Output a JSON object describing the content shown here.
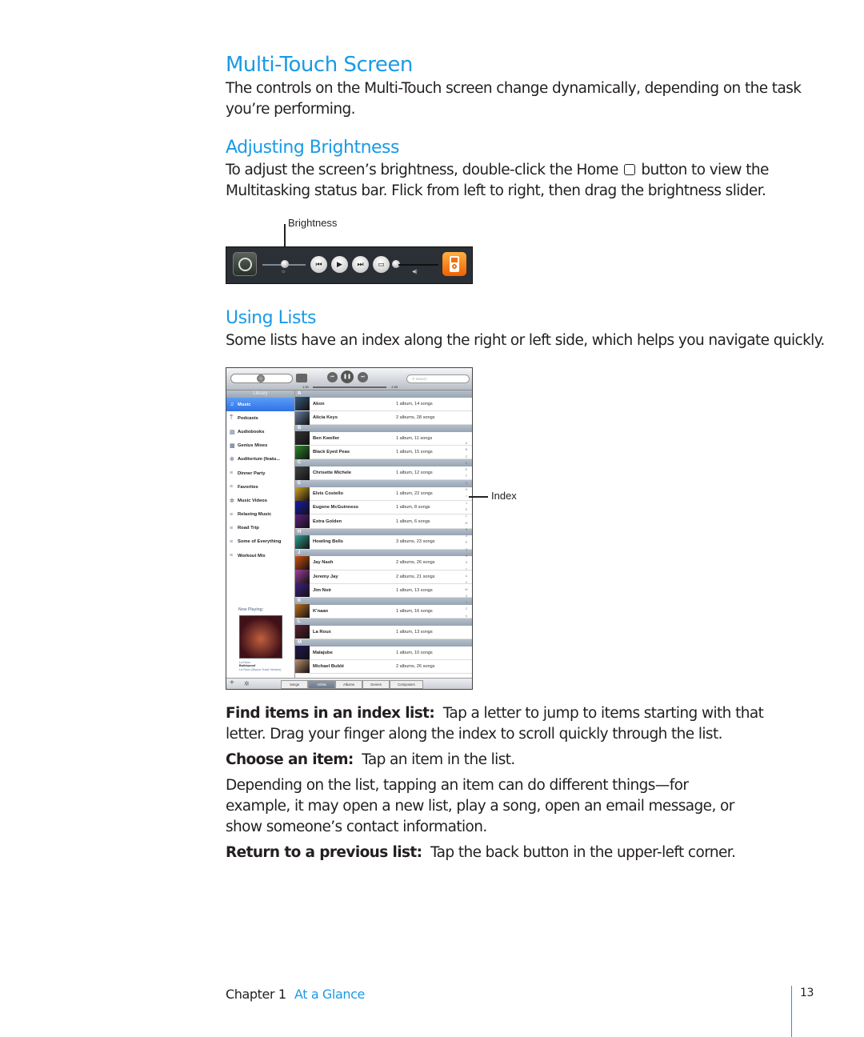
{
  "sections": {
    "title": "Multi-Touch Screen",
    "intro": "The controls on the Multi-Touch screen change dynamically, depending on the task you’re performing.",
    "brightness_heading": "Adjusting Brightness",
    "brightness_text_1": "To adjust the screen’s brightness, double-click the Home",
    "brightness_text_2": "button to view the Multitasking status bar. Flick from left to right, then drag the brightness slider.",
    "brightness_callout": "Brightness",
    "lists_heading": "Using Lists",
    "lists_text": "Some lists have an index along the right or left side, which helps you navigate quickly.",
    "index_callout": "Index",
    "find_label": "Find items in an index list:",
    "find_text": "Tap a letter to jump to items starting with that letter. Drag your finger along the index to scroll quickly through the list.",
    "choose_label": "Choose an item:",
    "choose_text": "Tap an item in the list.",
    "depending_text": "Depending on the list, tapping an item can do different things—for example, it may open a new list, play a song, open an email message, or show someone’s contact information.",
    "return_label": "Return to a previous list:",
    "return_text": "Tap the back button in the upper-left corner."
  },
  "brightness_bar": {
    "icons": [
      "rotation-lock-icon",
      "brightness-icon",
      "previous-icon",
      "play-icon",
      "next-icon",
      "airplay-icon",
      "volume-icon",
      "ipod-app-icon"
    ],
    "brightness_level": 0.45,
    "volume_level": 0.05
  },
  "ipad": {
    "toolbar": {
      "elapsed": "1:30",
      "remaining": "-1:55",
      "search_placeholder": "Search"
    },
    "library_label": "Library",
    "sidebar": [
      {
        "label": "Music",
        "icon": "♫",
        "selected": true
      },
      {
        "label": "Podcasts",
        "icon": "⍑"
      },
      {
        "label": "Audiobooks",
        "icon": "▤"
      },
      {
        "label": "Genius Mixes",
        "icon": "▦"
      },
      {
        "label": "Auditorium (featu...",
        "icon": "✲"
      },
      {
        "label": "Dinner Party",
        "icon": "≡"
      },
      {
        "label": "Favorites",
        "icon": "≡"
      },
      {
        "label": "Music Videos",
        "icon": "✲"
      },
      {
        "label": "Relaxing Music",
        "icon": "≡"
      },
      {
        "label": "Road Trip",
        "icon": "≡"
      },
      {
        "label": "Some of Everything",
        "icon": "≡"
      },
      {
        "label": "Workout Mix",
        "icon": "≡"
      }
    ],
    "now_playing": {
      "label": "Now Playing:",
      "artist": "La Roux",
      "song": "Bulletproof",
      "album": "La Roux (Bonus Track Version)"
    },
    "sections": [
      {
        "letter": "A",
        "rows": [
          {
            "name": "Akon",
            "count": "1 album, 14 songs",
            "color": "#3a5a80"
          },
          {
            "name": "Alicia Keys",
            "count": "2 albums, 28 songs",
            "color": "#6a7fa0"
          }
        ]
      },
      {
        "letter": "B",
        "rows": [
          {
            "name": "Ben Kweller",
            "count": "1 album, 11 songs",
            "color": "#333"
          },
          {
            "name": "Black Eyed Peas",
            "count": "1 album, 15 songs",
            "color": "#2a8a2a"
          }
        ]
      },
      {
        "letter": "C",
        "rows": [
          {
            "name": "Chrisette Michele",
            "count": "1 album, 12 songs",
            "color": "#444"
          }
        ]
      },
      {
        "letter": "E",
        "rows": [
          {
            "name": "Elvis Costello",
            "count": "1 album, 22 songs",
            "color": "#d0a020"
          },
          {
            "name": "Eugene McGuinness",
            "count": "1 album, 8 songs",
            "color": "#1a1ab0"
          },
          {
            "name": "Extra Golden",
            "count": "1 album, 6 songs",
            "color": "#602080"
          }
        ]
      },
      {
        "letter": "H",
        "rows": [
          {
            "name": "Howling Bells",
            "count": "3 albums, 23 songs",
            "color": "#30a090"
          }
        ]
      },
      {
        "letter": "J",
        "rows": [
          {
            "name": "Jay Nash",
            "count": "2 albums, 26 songs",
            "color": "#d05010"
          },
          {
            "name": "Jeremy Jay",
            "count": "2 albums, 21 songs",
            "color": "#a040a0"
          },
          {
            "name": "Jim Noir",
            "count": "1 album, 13 songs",
            "color": "#402080"
          }
        ]
      },
      {
        "letter": "K",
        "rows": [
          {
            "name": "K'naan",
            "count": "1 album, 16 songs",
            "color": "#c07020"
          }
        ]
      },
      {
        "letter": "L",
        "rows": [
          {
            "name": "La Roux",
            "count": "1 album, 13 songs",
            "color": "#602030"
          }
        ]
      },
      {
        "letter": "M",
        "rows": [
          {
            "name": "Malajube",
            "count": "1 album, 10 songs",
            "color": "#201850"
          },
          {
            "name": "Michael Bublé",
            "count": "2 albums, 26 songs",
            "color": "#c09070"
          }
        ]
      }
    ],
    "index_letters": [
      "A",
      "B",
      "C",
      "D",
      "E",
      "F",
      "G",
      "H",
      "I",
      "J",
      "K",
      "L",
      "M",
      "N",
      "O",
      "P",
      "Q",
      "R",
      "S",
      "T",
      "U",
      "V",
      "W",
      "X",
      "Y",
      "Z",
      "#"
    ],
    "tabs": [
      {
        "label": "Songs"
      },
      {
        "label": "Artists",
        "selected": true
      },
      {
        "label": "Albums"
      },
      {
        "label": "Genres"
      },
      {
        "label": "Composers"
      }
    ],
    "accent": "#2f72e6"
  },
  "footer": {
    "chapter": "Chapter 1",
    "chapter_title": "At a Glance",
    "page": "13"
  }
}
